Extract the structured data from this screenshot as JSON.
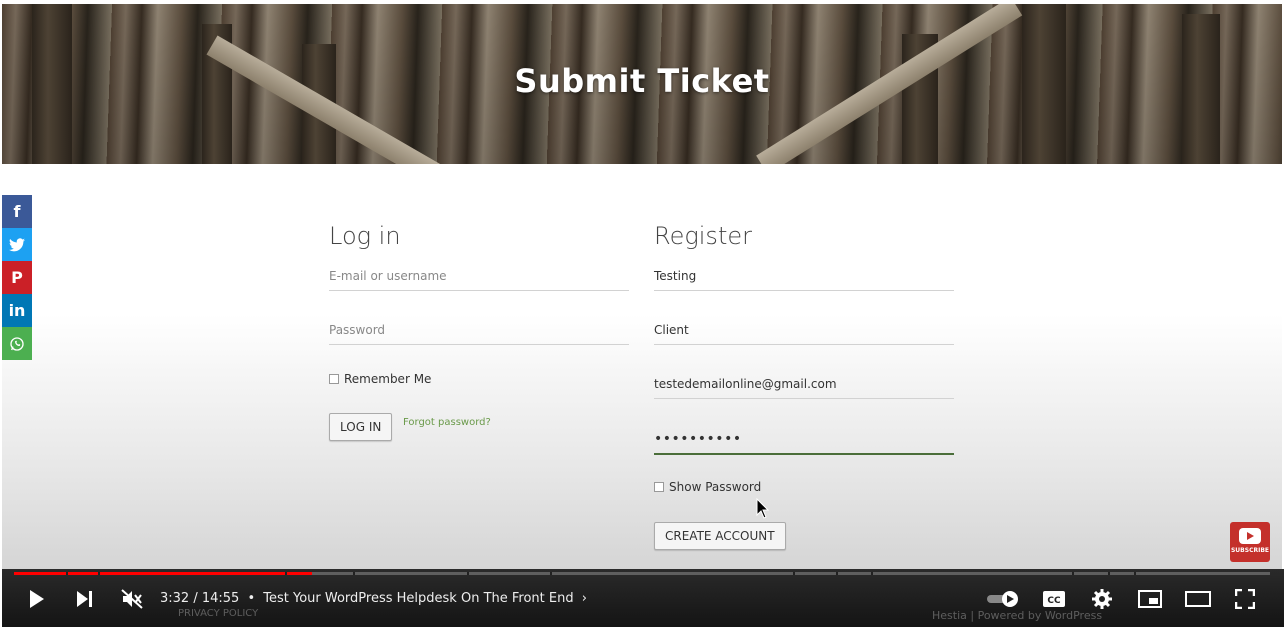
{
  "hero": {
    "title": "Submit Ticket"
  },
  "share": [
    {
      "icon": "facebook-icon",
      "glyph": "f",
      "color": "#3b5998"
    },
    {
      "icon": "twitter-icon",
      "glyph": "🐦",
      "color": "#1da1f2"
    },
    {
      "icon": "pinterest-icon",
      "glyph": "P",
      "color": "#cb2027"
    },
    {
      "icon": "linkedin-icon",
      "glyph": "in",
      "color": "#0077b5"
    },
    {
      "icon": "whatsapp-icon",
      "glyph": "✆",
      "color": "#4caf50"
    }
  ],
  "login": {
    "title": "Log in",
    "username_placeholder": "E-mail or username",
    "password_placeholder": "Password",
    "remember_label": "Remember Me",
    "button_label": "LOG IN",
    "forgot_label": "Forgot password?"
  },
  "register": {
    "title": "Register",
    "first_name_value": "Testing",
    "last_name_value": "Client",
    "email_value": "testedemailonline@gmail.com",
    "password_value": "••••••••••",
    "show_password_label": "Show Password",
    "button_label": "CREATE ACCOUNT"
  },
  "youtube_badge": {
    "label": "SUBSCRIBE"
  },
  "player": {
    "time": "3:32 / 14:55",
    "separator": "•",
    "video_title": "Test Your WordPress Helpdesk On The Front End",
    "progress_fraction": 0.237
  },
  "footer": {
    "privacy": "PRIVACY POLICY",
    "credit": "Hestia | Powered by WordPress"
  },
  "colors": {
    "accent_green": "#4b6e3a",
    "youtube_red": "#ff0000"
  }
}
